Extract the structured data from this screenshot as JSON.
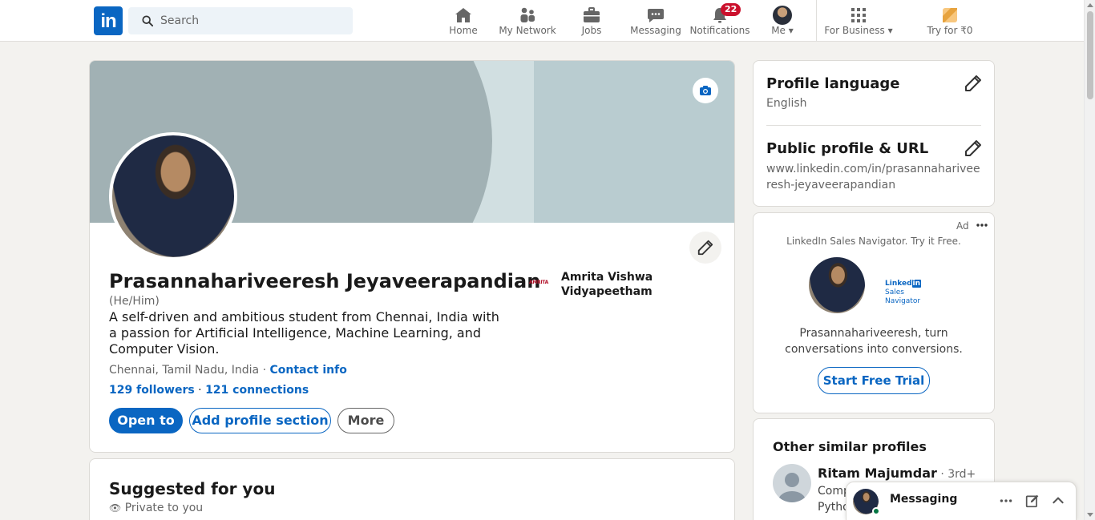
{
  "nav": {
    "search_placeholder": "Search",
    "items": [
      {
        "label": "Home"
      },
      {
        "label": "My Network"
      },
      {
        "label": "Jobs"
      },
      {
        "label": "Messaging"
      },
      {
        "label": "Notifications",
        "badge": "22"
      },
      {
        "label": "Me"
      },
      {
        "label": "For Business"
      },
      {
        "label": "Try for ₹0"
      }
    ],
    "logo": "in"
  },
  "profile": {
    "name": "Prasannahariveeresh Jeyaveerapandian",
    "pronouns": "(He/Him)",
    "headline": "A self-driven and ambitious student from Chennai, India with a passion for Artificial Intelligence, Machine Learning, and Computer Vision.",
    "location": "Chennai, Tamil Nadu, India",
    "location_sep": " · ",
    "contact_info": "Contact info",
    "followers": "129 followers",
    "stats_sep": " · ",
    "connections": "121 connections",
    "education": "Amrita Vishwa Vidyapeetham",
    "edu_logo_text": "AMRITA",
    "buttons": {
      "open_to": "Open to",
      "add_section": "Add profile section",
      "more": "More"
    }
  },
  "suggested": {
    "title": "Suggested for you",
    "subtitle": "Private to you"
  },
  "sidebar": {
    "language_title": "Profile language",
    "language_value": "English",
    "url_title": "Public profile & URL",
    "url_value": "www.linkedin.com/in/prasannahariveeresh-jeyaveerapandian"
  },
  "ad": {
    "label": "Ad",
    "tagline": "LinkedIn Sales Navigator. Try it Free.",
    "brand_top": "Linked",
    "brand_in": "in",
    "brand_bottom": "Sales Navigator",
    "text": "Prasannahariveeresh, turn conversations into conversions.",
    "cta": "Start Free Trial"
  },
  "similar": {
    "title": "Other similar profiles",
    "person_name": "Ritam Majumdar",
    "person_degree": " · 3rd+",
    "person_line1": "Comp",
    "person_line2": "Pytho"
  },
  "messaging": {
    "title": "Messaging"
  },
  "colors": {
    "brand": "#0a66c2",
    "badge": "#cb112d",
    "online": "#057642"
  }
}
